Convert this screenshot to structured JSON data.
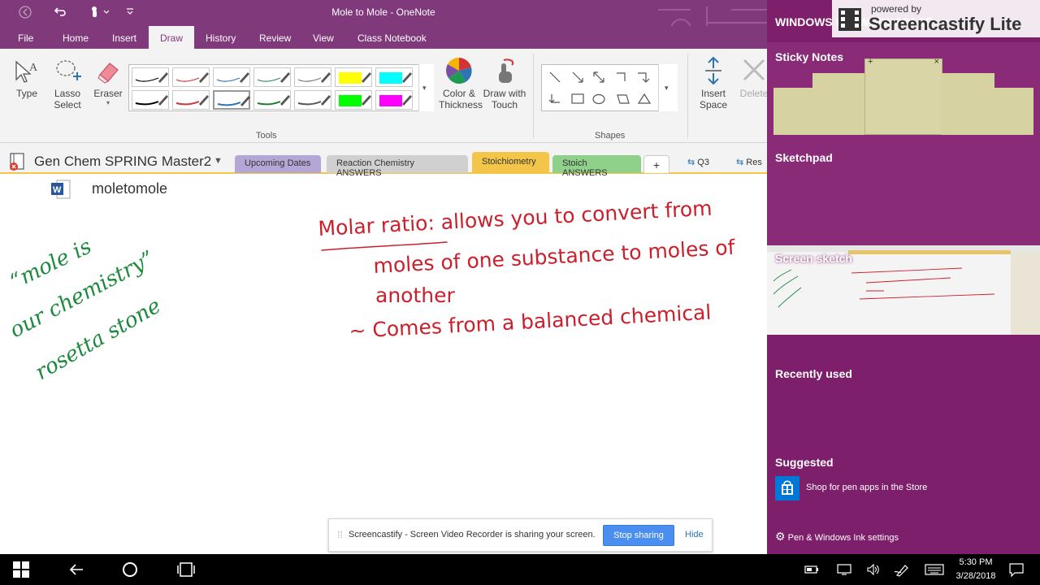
{
  "window": {
    "title": "Mole to Mole  -  OneNote"
  },
  "menu": [
    {
      "label": "File"
    },
    {
      "label": "Home"
    },
    {
      "label": "Insert"
    },
    {
      "label": "Draw"
    },
    {
      "label": "History"
    },
    {
      "label": "Review"
    },
    {
      "label": "View"
    },
    {
      "label": "Class Notebook"
    }
  ],
  "ribbon": {
    "type_label": "Type",
    "lasso_label": "Lasso\nSelect",
    "lasso_line1": "Lasso",
    "lasso_line2": "Select",
    "eraser_label": "Eraser",
    "color_line1": "Color &",
    "color_line2": "Thickness",
    "drawtouch_line1": "Draw with",
    "drawtouch_line2": "Touch",
    "insertspace_line1": "Insert",
    "insertspace_line2": "Space",
    "delete_label": "Delete",
    "tools_group": "Tools",
    "shapes_group": "Shapes",
    "pens_row1": [
      "#000000",
      "#d13438",
      "#2e74b5",
      "#2e8b57",
      "#777777",
      "#ffff00",
      "#00ffff"
    ],
    "pens_row2": [
      "#000000",
      "#d13438",
      "#2e74b5",
      "#1e7b34",
      "#555555",
      "#00ff00",
      "#ff00ff"
    ]
  },
  "notebook": {
    "name": "Gen Chem SPRING Master2",
    "sections": [
      {
        "label": "Upcoming Dates",
        "color": "#b4a7d6"
      },
      {
        "label": "Reaction Chemistry ANSWERS",
        "color": "#cfcfcf"
      },
      {
        "label": "Stoichiometry",
        "color": "#f3c64a"
      },
      {
        "label": "Stoich ANSWERS",
        "color": "#8fd18b"
      }
    ],
    "add_tab": "+",
    "extra_tabs": [
      {
        "label": "Q3"
      },
      {
        "label": "Res"
      }
    ]
  },
  "page": {
    "attachment_name": "moletomole",
    "ink_green": [
      "“mole is",
      "our chemistry”",
      "rosetta stone"
    ],
    "ink_red": [
      "Molar ratio: allows you to convert from",
      "moles of one substance to moles of",
      "another",
      "~ Comes from a balanced chemical"
    ]
  },
  "panel": {
    "header": "WINDOWS INK WORKSPACE",
    "watermark_top": "powered by",
    "watermark_brand": "Screencastify Lite",
    "sticky_notes": "Sticky Notes",
    "sketchpad": "Sketchpad",
    "screen_sketch": "Screen sketch",
    "recently_used": "Recently used",
    "suggested": "Suggested",
    "store_item": "Shop for pen apps in the Store",
    "settings": "Pen & Windows Ink settings"
  },
  "share_bar": {
    "message": "Screencastify - Screen Video Recorder is sharing your screen.",
    "stop_label": "Stop sharing",
    "hide_label": "Hide"
  },
  "taskbar": {
    "time": "5:30 PM",
    "date": "3/28/2018"
  },
  "colors": {
    "accent": "#80397b",
    "panel": "#7e1f6b",
    "ink_red": "#cc1f2c",
    "ink_green": "#1c8a3c"
  }
}
